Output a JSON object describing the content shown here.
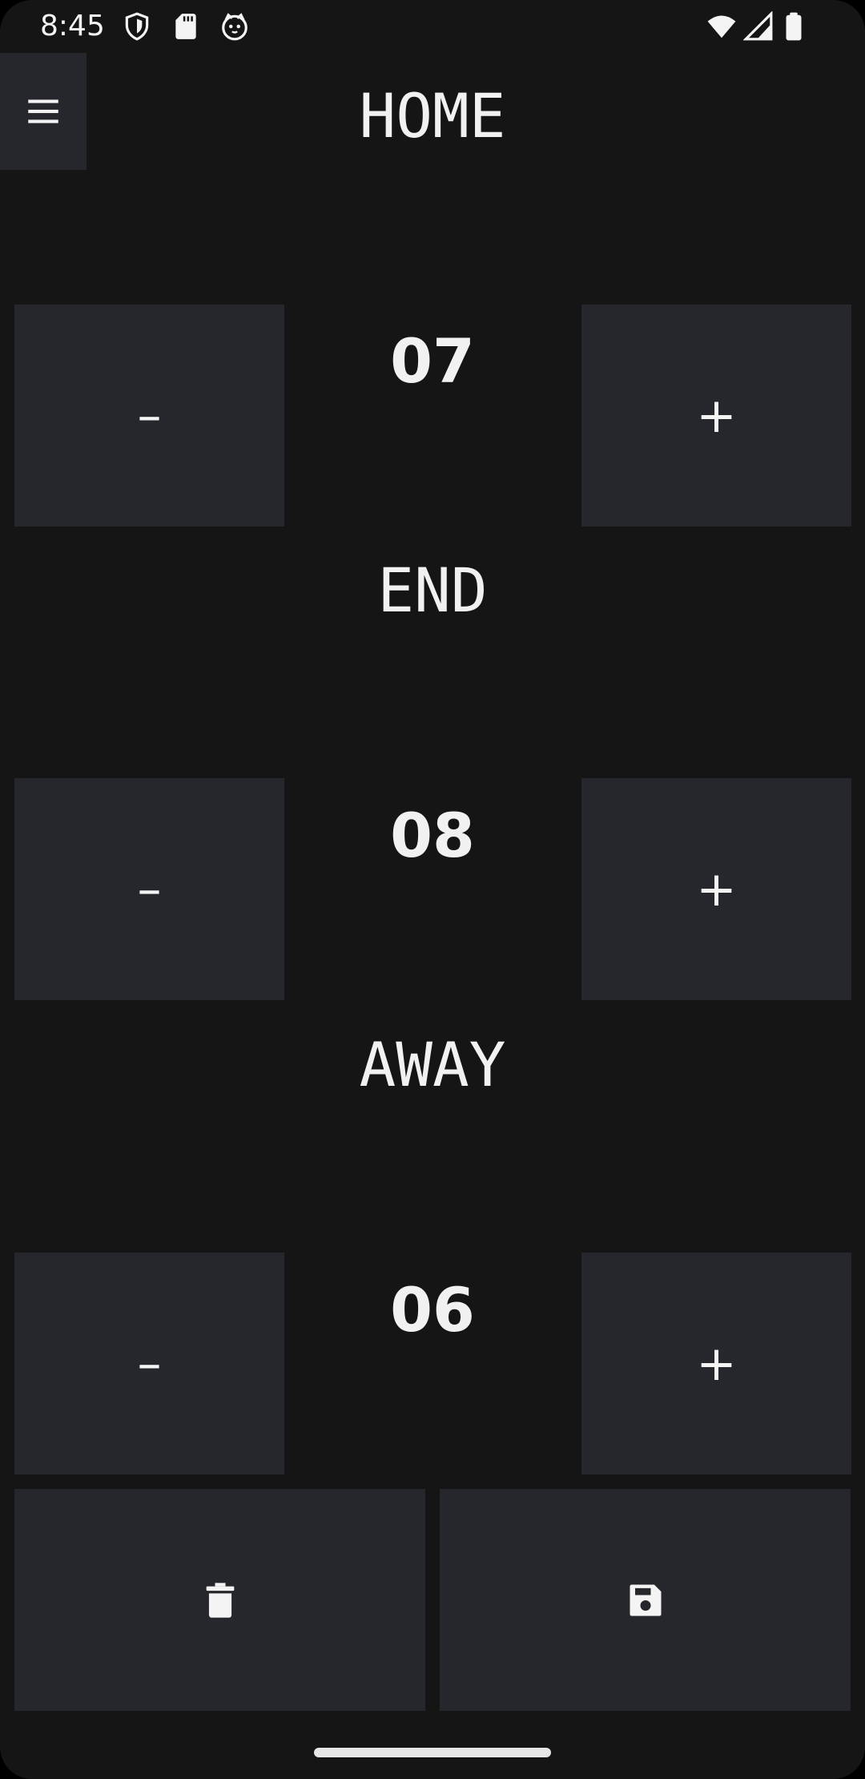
{
  "status_bar": {
    "time": "8:45",
    "icons": [
      "shield-icon",
      "sd-card-icon",
      "cat-face-icon",
      "wifi-icon",
      "signal-icon",
      "battery-icon"
    ]
  },
  "menu": {
    "icon": "hamburger-menu-icon"
  },
  "sections": [
    {
      "label": "HOME",
      "score": "07",
      "minus_label": "–",
      "plus_label": "+"
    },
    {
      "label": "END",
      "score": "08",
      "minus_label": "–",
      "plus_label": "+"
    },
    {
      "label": "AWAY",
      "score": "06",
      "minus_label": "–",
      "plus_label": "+"
    }
  ],
  "actions": {
    "delete_icon": "trash-icon",
    "save_icon": "floppy-save-icon"
  },
  "colors": {
    "background": "#151515",
    "button": "#26272c",
    "text": "#f1f1f1"
  }
}
